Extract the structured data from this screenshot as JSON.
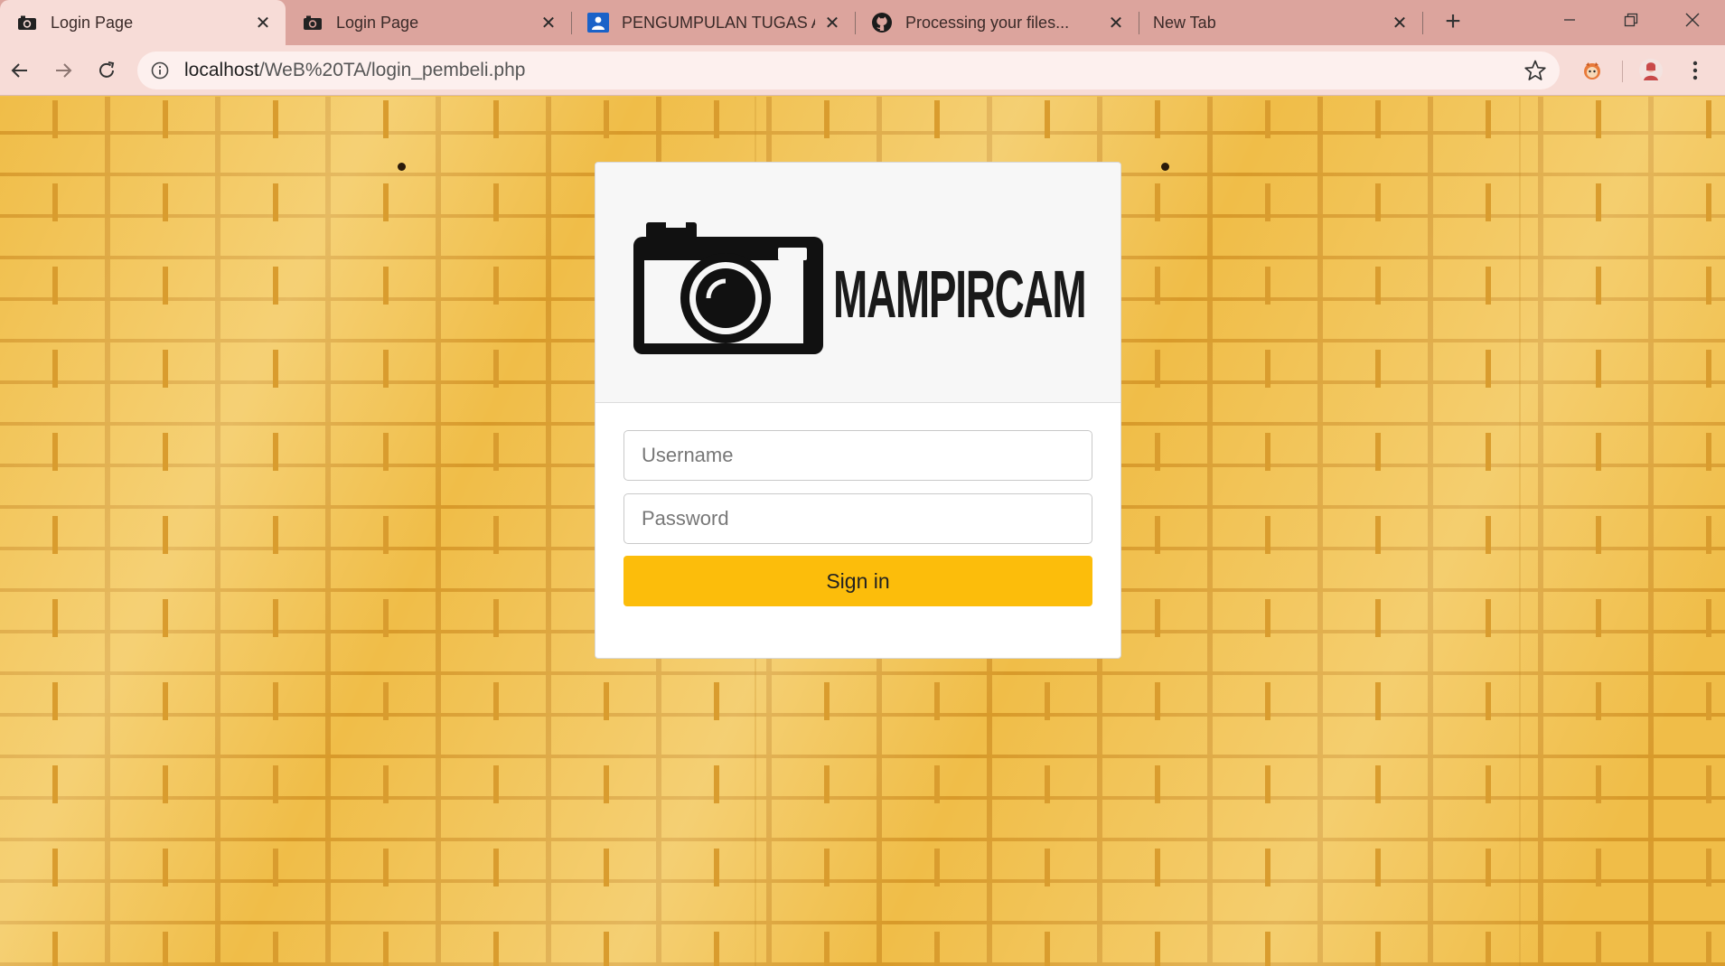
{
  "browser": {
    "tabs": [
      {
        "title": "Login Page",
        "icon": "camera-icon",
        "active": true
      },
      {
        "title": "Login Page",
        "icon": "camera-icon",
        "active": false
      },
      {
        "title": "PENGUMPULAN TUGAS AK",
        "icon": "classroom-icon",
        "active": false
      },
      {
        "title": "Processing your files...",
        "icon": "github-icon",
        "active": false
      },
      {
        "title": "New Tab",
        "icon": "",
        "active": false
      }
    ],
    "new_tab_label": "+",
    "url_host": "localhost",
    "url_path": "/WeB%20TA/login_pembeli.php",
    "theme_color": "#dca49d"
  },
  "login": {
    "brand_name": "MAMPIRCAM",
    "username_placeholder": "Username",
    "password_placeholder": "Password",
    "signin_label": "Sign in",
    "accent_color": "#fcbd0b"
  }
}
